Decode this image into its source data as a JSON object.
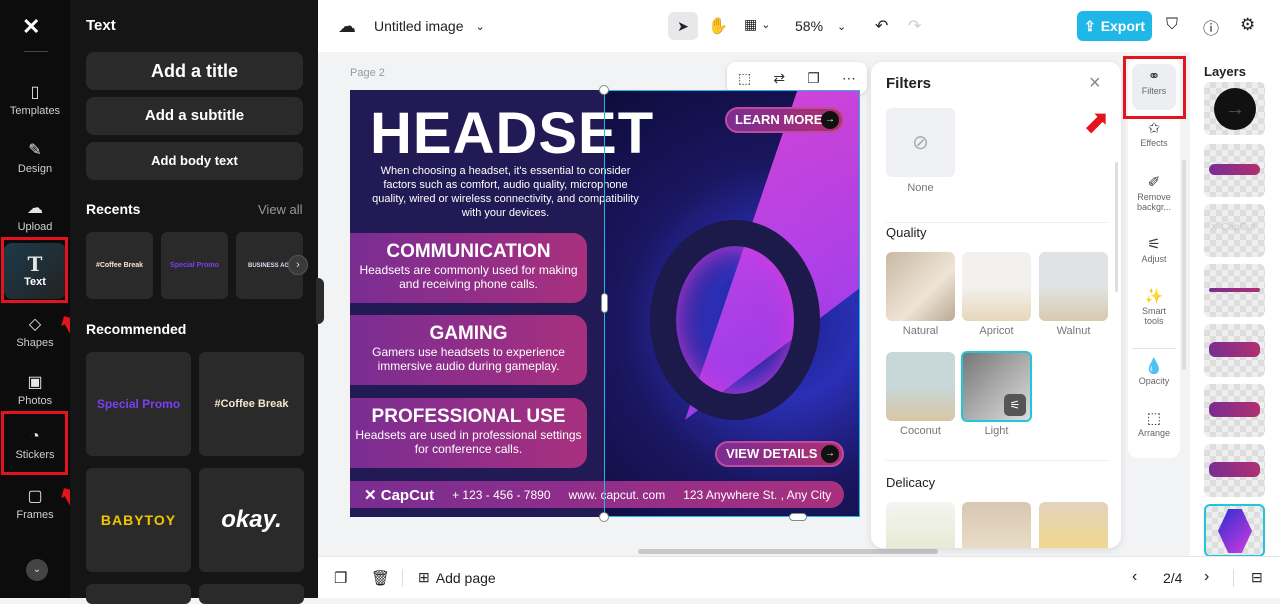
{
  "rail": {
    "items": [
      {
        "label": "Templates",
        "icon": "templates-icon"
      },
      {
        "label": "Design",
        "icon": "design-icon"
      },
      {
        "label": "Upload",
        "icon": "upload-icon"
      },
      {
        "label": "Text",
        "icon": "text-icon"
      },
      {
        "label": "Shapes",
        "icon": "shapes-icon"
      },
      {
        "label": "Photos",
        "icon": "photos-icon"
      },
      {
        "label": "Stickers",
        "icon": "stickers-icon"
      },
      {
        "label": "Frames",
        "icon": "frames-icon"
      }
    ]
  },
  "panel": {
    "title": "Text",
    "add_title": "Add a title",
    "add_subtitle": "Add a subtitle",
    "add_body": "Add body text",
    "recents": "Recents",
    "view_all": "View all",
    "recent_items": [
      "#Coffee Break",
      "Special Promo",
      "BUSINESS AGENDA"
    ],
    "recommended": "Recommended",
    "rec_items": [
      "Special Promo",
      "#Coffee Break",
      "BABYTOY",
      "okay."
    ]
  },
  "topbar": {
    "doc_title": "Untitled image",
    "zoom": "58%",
    "export": "Export"
  },
  "canvas": {
    "page_label": "Page 2"
  },
  "poster": {
    "headline": "HEADSET",
    "intro": "When choosing a headset, it's essential to consider factors such as comfort, audio quality, microphone quality, wired or wireless connectivity, and compatibility with your devices.",
    "learn_more": "LEARN MORE",
    "view_details": "VIEW DETAILS",
    "sections": [
      {
        "title": "COMMUNICATION",
        "text": "Headsets are commonly used for making and receiving phone calls."
      },
      {
        "title": "GAMING",
        "text": "Gamers use headsets to experience immersive audio during gameplay."
      },
      {
        "title": "PROFESSIONAL USE",
        "text": "Headsets are used in professional settings for conference calls."
      }
    ],
    "brand": "CapCut",
    "phone": "+ 123 - 456 - 7890",
    "web": "www. capcut. com",
    "address": "123 Anywhere St. , Any City"
  },
  "filters": {
    "title": "Filters",
    "none": "None",
    "quality": "Quality",
    "quality_items": [
      "Natural",
      "Apricot",
      "Walnut",
      "Coconut",
      "Light"
    ],
    "delicacy": "Delicacy"
  },
  "tools": [
    "Filters",
    "Effects",
    "Remove backgr...",
    "Adjust",
    "Smart tools",
    "Opacity",
    "Arrange"
  ],
  "layers": {
    "title": "Layers",
    "capcut_label": "CapCut"
  },
  "bottom": {
    "add_page": "Add page",
    "page_indicator": "2/4"
  },
  "colors": {
    "accent": "#1fb6e8",
    "highlight": "#e3141d"
  }
}
